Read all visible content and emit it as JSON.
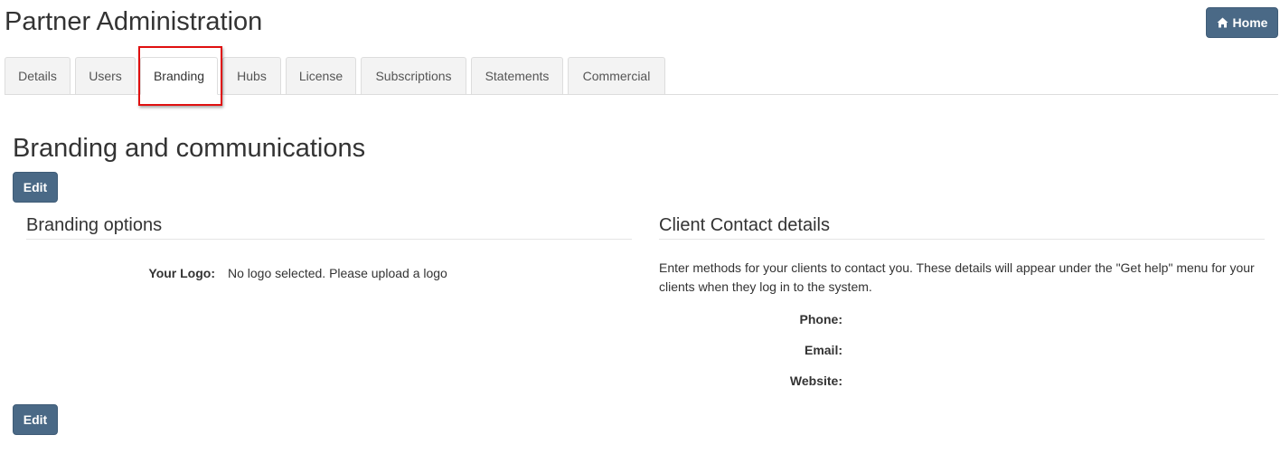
{
  "header": {
    "title": "Partner Administration",
    "home_label": "Home"
  },
  "tabs": [
    {
      "label": "Details",
      "active": false
    },
    {
      "label": "Users",
      "active": false
    },
    {
      "label": "Branding",
      "active": true
    },
    {
      "label": "Hubs",
      "active": false
    },
    {
      "label": "License",
      "active": false
    },
    {
      "label": "Subscriptions",
      "active": false
    },
    {
      "label": "Statements",
      "active": false
    },
    {
      "label": "Commercial",
      "active": false
    }
  ],
  "main": {
    "heading": "Branding and communications",
    "edit_label": "Edit",
    "branding": {
      "title": "Branding options",
      "logo_label": "Your Logo:",
      "logo_value": "No logo selected. Please upload a logo"
    },
    "contact": {
      "title": "Client Contact details",
      "description": "Enter methods for your clients to contact you. These details will appear under the \"Get help\" menu for your clients when they log in to the system.",
      "phone_label": "Phone:",
      "email_label": "Email:",
      "website_label": "Website:"
    }
  },
  "colors": {
    "primary_button": "#4a6986",
    "highlight": "#e01010"
  }
}
